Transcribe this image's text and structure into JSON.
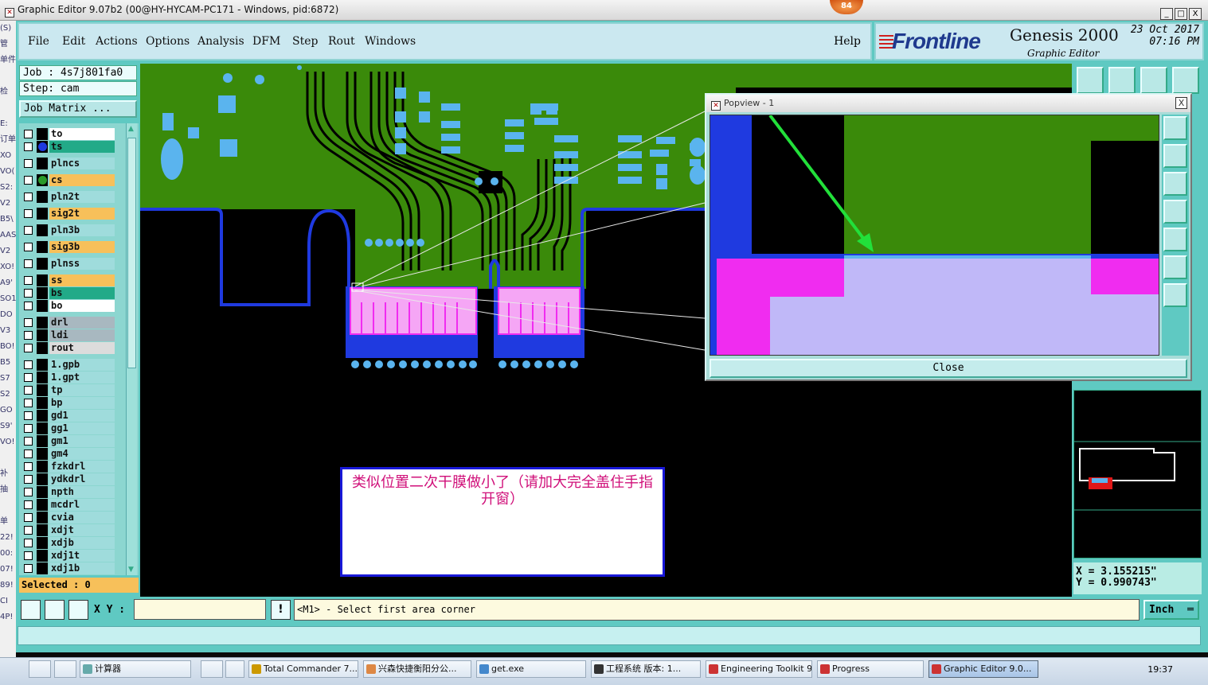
{
  "window": {
    "title": "Graphic Editor 9.07b2 (00@HY-HYCAM-PC171 - Windows, pid:6872)",
    "badge": "84",
    "min": "_",
    "max": "□",
    "close": "X"
  },
  "menu": {
    "items": [
      "File",
      "Edit",
      "Actions",
      "Options",
      "Analysis",
      "DFM",
      "Step",
      "Rout",
      "Windows"
    ],
    "help": "Help"
  },
  "logo": {
    "brand": "Frontline",
    "product": "Genesis 2000",
    "subtitle": "Graphic Editor",
    "date": "23 Oct 2017",
    "time": "07:16 PM"
  },
  "job": {
    "job": "Job : 4s7j801fa0",
    "step": "Step: cam",
    "matrix": "Job Matrix ..."
  },
  "layers": [
    {
      "name": "to",
      "bg": "#ffffff",
      "dot": ""
    },
    {
      "name": "ts",
      "bg": "#22aa88",
      "dot": "#1f3ae0"
    },
    {
      "name": "plncs",
      "bg": "#9fdcdc",
      "dot": ""
    },
    {
      "name": "cs",
      "bg": "#f7c05a",
      "dot": "#2a9a2a"
    },
    {
      "name": "pln2t",
      "bg": "#9fdcdc",
      "dot": ""
    },
    {
      "name": "sig2t",
      "bg": "#f7c05a",
      "dot": ""
    },
    {
      "name": "pln3b",
      "bg": "#9fdcdc",
      "dot": ""
    },
    {
      "name": "sig3b",
      "bg": "#f7c05a",
      "dot": ""
    },
    {
      "name": "plnss",
      "bg": "#9fdcdc",
      "dot": ""
    },
    {
      "name": "ss",
      "bg": "#f7c05a",
      "dot": ""
    },
    {
      "name": "bs",
      "bg": "#22aa88",
      "dot": ""
    },
    {
      "name": "bo",
      "bg": "#ffffff",
      "dot": ""
    },
    {
      "name": "drl",
      "bg": "#a8b8c0",
      "dot": ""
    },
    {
      "name": "ldi",
      "bg": "#a8b8c0",
      "dot": ""
    },
    {
      "name": "rout",
      "bg": "#dcdcdc",
      "dot": ""
    },
    {
      "name": "1.gpb",
      "bg": "#9fdcdc",
      "dot": ""
    },
    {
      "name": "1.gpt",
      "bg": "#9fdcdc",
      "dot": ""
    },
    {
      "name": "tp",
      "bg": "#9fdcdc",
      "dot": ""
    },
    {
      "name": "bp",
      "bg": "#9fdcdc",
      "dot": ""
    },
    {
      "name": "gd1",
      "bg": "#9fdcdc",
      "dot": ""
    },
    {
      "name": "gg1",
      "bg": "#9fdcdc",
      "dot": ""
    },
    {
      "name": "gm1",
      "bg": "#9fdcdc",
      "dot": ""
    },
    {
      "name": "gm4",
      "bg": "#9fdcdc",
      "dot": ""
    },
    {
      "name": "fzkdrl",
      "bg": "#9fdcdc",
      "dot": ""
    },
    {
      "name": "ydkdrl",
      "bg": "#9fdcdc",
      "dot": ""
    },
    {
      "name": "npth",
      "bg": "#9fdcdc",
      "dot": ""
    },
    {
      "name": "mcdrl",
      "bg": "#9fdcdc",
      "dot": ""
    },
    {
      "name": "cvia",
      "bg": "#9fdcdc",
      "dot": ""
    },
    {
      "name": "xdjt",
      "bg": "#9fdcdc",
      "dot": ""
    },
    {
      "name": "xdjb",
      "bg": "#9fdcdc",
      "dot": ""
    },
    {
      "name": "xdj1t",
      "bg": "#9fdcdc",
      "dot": ""
    },
    {
      "name": "xdj1b",
      "bg": "#9fdcdc",
      "dot": ""
    }
  ],
  "selected": "Selected : 0",
  "popview": {
    "title": "Popview - 1",
    "close_label": "Close",
    "close_x": "X"
  },
  "note": "类似位置二次干膜做小了（请加大完全盖住手指开窗）",
  "coords": {
    "x": "X = 3.155215\"",
    "y": "Y = 0.990743\""
  },
  "command": {
    "xy_label": "X Y :",
    "xy_value": "",
    "excl": "!",
    "prompt": "<M1> - Select first area corner",
    "unit": "Inch"
  },
  "taskbar": [
    {
      "label": "计算器",
      "color": "#6aa"
    },
    {
      "label": "Total Commander 7....",
      "color": "#c90"
    },
    {
      "label": "兴森快捷衡阳分公...",
      "color": "#d84"
    },
    {
      "label": "get.exe",
      "color": "#48c"
    },
    {
      "label": "工程系统  版本: 1...",
      "color": "#333"
    },
    {
      "label": "Engineering Toolkit 9...",
      "color": "#c33"
    },
    {
      "label": "Progress",
      "color": "#c33"
    },
    {
      "label": "Graphic Editor 9.0...",
      "color": "#c33"
    }
  ],
  "clock": "19:37",
  "left_strip": [
    "(S)",
    "管",
    "单件",
    "",
    "检",
    "",
    "E:",
    "订单",
    "XO",
    "VO(",
    "S2:",
    "V2",
    "B5\\",
    "AAS",
    "V2",
    "XO!",
    "A9'",
    "SO1",
    "DO",
    "V3",
    "BO!",
    "B5",
    "S7",
    "S2",
    "GO",
    "S9'",
    "VO!",
    "",
    "补",
    "抽",
    "",
    "单",
    "22!",
    "00:",
    "07!",
    "89!",
    "CI",
    "4P!"
  ],
  "colors": {
    "teal": "#5fc9c2",
    "board_green": "#3a8a0a",
    "copper_blue": "#1f3ae0",
    "pad_blue": "#5ab4ee",
    "gold_pink": "#f02cf0",
    "highlight": "#c0b8f8",
    "arrow_green": "#22e03a"
  }
}
